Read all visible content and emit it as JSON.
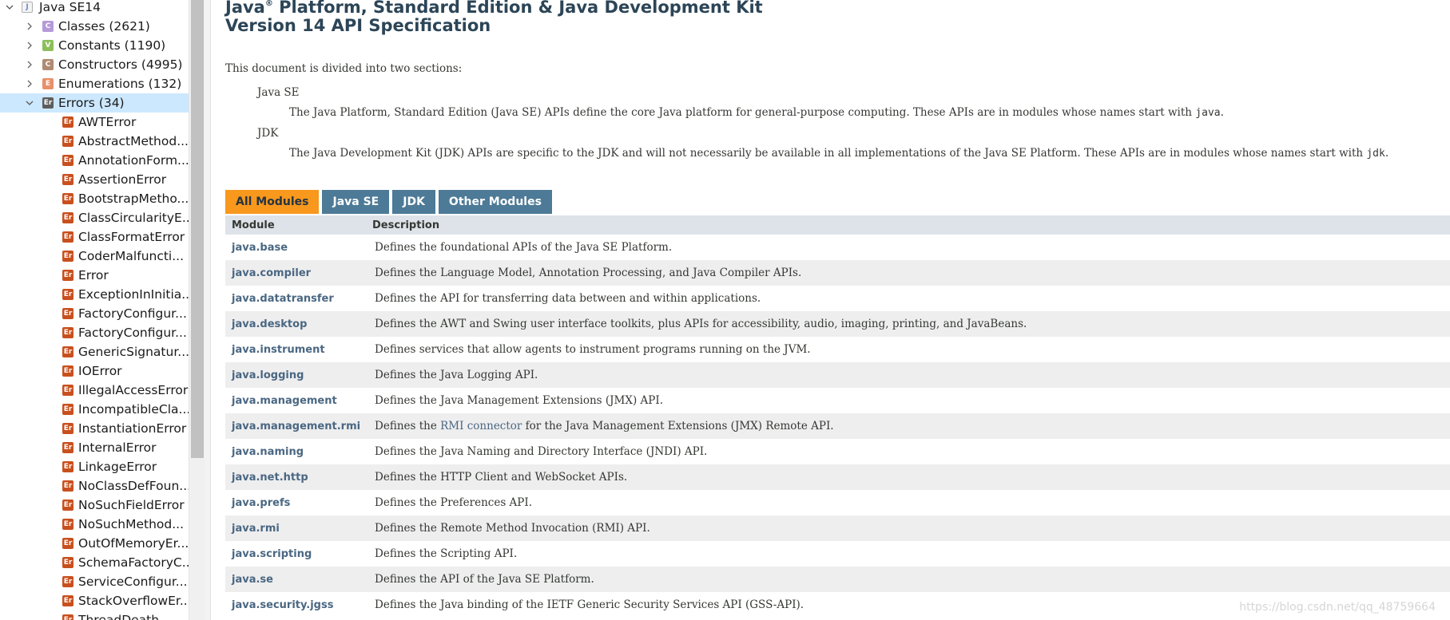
{
  "tree": {
    "root": {
      "label": "Java SE14",
      "icon": "package-icon"
    },
    "groups": [
      {
        "label": "Classes (2621)",
        "icon_letter": "C",
        "kind": "cls"
      },
      {
        "label": "Constants (1190)",
        "icon_letter": "V",
        "kind": "cst"
      },
      {
        "label": "Constructors (4995)",
        "icon_letter": "C",
        "kind": "ctor"
      },
      {
        "label": "Enumerations (132)",
        "icon_letter": "E",
        "kind": "enm"
      },
      {
        "label": "Errors (34)",
        "icon_letter": "Er",
        "kind": "err"
      }
    ],
    "error_items": [
      "AWTError",
      "AbstractMethod...",
      "AnnotationForm...",
      "AssertionError",
      "BootstrapMetho...",
      "ClassCircularityE...",
      "ClassFormatError",
      "CoderMalfuncti...",
      "Error",
      "ExceptionInInitia...",
      "FactoryConfigur...",
      "FactoryConfigur...",
      "GenericSignatur...",
      "IOError",
      "IllegalAccessError",
      "IncompatibleCla...",
      "InstantiationError",
      "InternalError",
      "LinkageError",
      "NoClassDefFoun...",
      "NoSuchFieldError",
      "NoSuchMethod...",
      "OutOfMemoryEr...",
      "SchemaFactoryC...",
      "ServiceConfigur...",
      "StackOverflowEr...",
      "ThreadDeath"
    ],
    "leaf_icon_letter": "Er"
  },
  "doc": {
    "title_line1_a": "Java",
    "title_line1_sup": "®",
    "title_line1_b": " Platform, Standard Edition & Java Development Kit",
    "title_line2": "Version 14 API Specification",
    "intro": "This document is divided into two sections:",
    "sections": [
      {
        "term": "Java SE",
        "def_pre": "The Java Platform, Standard Edition (Java SE) APIs define the core Java platform for general-purpose computing. These APIs are in modules whose names start with ",
        "def_code": "java",
        "def_post": "."
      },
      {
        "term": "JDK",
        "def_pre": "The Java Development Kit (JDK) APIs are specific to the JDK and will not necessarily be available in all implementations of the Java SE Platform. These APIs are in modules whose names start with ",
        "def_code": "jdk",
        "def_post": "."
      }
    ],
    "tabs": [
      "All Modules",
      "Java SE",
      "JDK",
      "Other Modules"
    ],
    "table": {
      "col_module": "Module",
      "col_description": "Description",
      "rows": [
        {
          "module": "java.base",
          "desc": "Defines the foundational APIs of the Java SE Platform."
        },
        {
          "module": "java.compiler",
          "desc": "Defines the Language Model, Annotation Processing, and Java Compiler APIs."
        },
        {
          "module": "java.datatransfer",
          "desc": "Defines the API for transferring data between and within applications."
        },
        {
          "module": "java.desktop",
          "desc": "Defines the AWT and Swing user interface toolkits, plus APIs for accessibility, audio, imaging, printing, and JavaBeans."
        },
        {
          "module": "java.instrument",
          "desc": "Defines services that allow agents to instrument programs running on the JVM."
        },
        {
          "module": "java.logging",
          "desc": "Defines the Java Logging API."
        },
        {
          "module": "java.management",
          "desc": "Defines the Java Management Extensions (JMX) API."
        },
        {
          "module": "java.management.rmi",
          "desc_pre": "Defines the ",
          "desc_link": "RMI connector",
          "desc_post": " for the Java Management Extensions (JMX) Remote API."
        },
        {
          "module": "java.naming",
          "desc": "Defines the Java Naming and Directory Interface (JNDI) API."
        },
        {
          "module": "java.net.http",
          "desc": "Defines the HTTP Client and WebSocket APIs."
        },
        {
          "module": "java.prefs",
          "desc": "Defines the Preferences API."
        },
        {
          "module": "java.rmi",
          "desc": "Defines the Remote Method Invocation (RMI) API."
        },
        {
          "module": "java.scripting",
          "desc": "Defines the Scripting API."
        },
        {
          "module": "java.se",
          "desc": "Defines the API of the Java SE Platform."
        },
        {
          "module": "java.security.jgss",
          "desc": "Defines the Java binding of the IETF Generic Security Services API (GSS-API)."
        }
      ]
    },
    "watermark": "https://blog.csdn.net/qq_48759664"
  },
  "colors": {
    "tab_active": "#f8981d",
    "tab_inactive": "#4d7a97",
    "module_link": "#4a6782",
    "tree_selected": "#cce8ff"
  }
}
